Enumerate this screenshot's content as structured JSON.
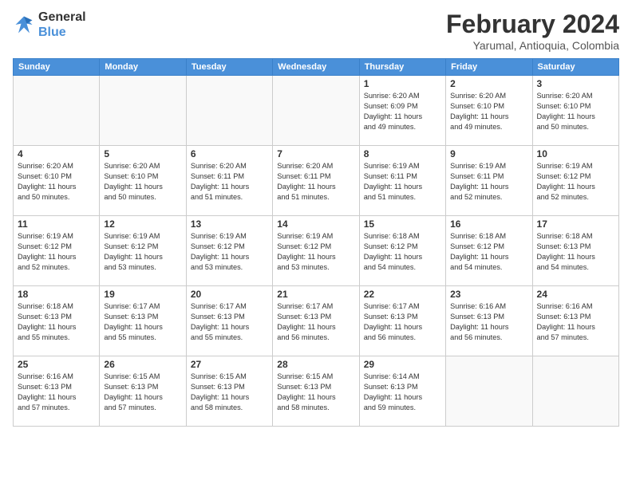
{
  "header": {
    "logo_line1": "General",
    "logo_line2": "Blue",
    "month": "February 2024",
    "location": "Yarumal, Antioquia, Colombia"
  },
  "weekdays": [
    "Sunday",
    "Monday",
    "Tuesday",
    "Wednesday",
    "Thursday",
    "Friday",
    "Saturday"
  ],
  "weeks": [
    [
      {
        "day": "",
        "info": ""
      },
      {
        "day": "",
        "info": ""
      },
      {
        "day": "",
        "info": ""
      },
      {
        "day": "",
        "info": ""
      },
      {
        "day": "1",
        "info": "Sunrise: 6:20 AM\nSunset: 6:09 PM\nDaylight: 11 hours\nand 49 minutes."
      },
      {
        "day": "2",
        "info": "Sunrise: 6:20 AM\nSunset: 6:10 PM\nDaylight: 11 hours\nand 49 minutes."
      },
      {
        "day": "3",
        "info": "Sunrise: 6:20 AM\nSunset: 6:10 PM\nDaylight: 11 hours\nand 50 minutes."
      }
    ],
    [
      {
        "day": "4",
        "info": "Sunrise: 6:20 AM\nSunset: 6:10 PM\nDaylight: 11 hours\nand 50 minutes."
      },
      {
        "day": "5",
        "info": "Sunrise: 6:20 AM\nSunset: 6:10 PM\nDaylight: 11 hours\nand 50 minutes."
      },
      {
        "day": "6",
        "info": "Sunrise: 6:20 AM\nSunset: 6:11 PM\nDaylight: 11 hours\nand 51 minutes."
      },
      {
        "day": "7",
        "info": "Sunrise: 6:20 AM\nSunset: 6:11 PM\nDaylight: 11 hours\nand 51 minutes."
      },
      {
        "day": "8",
        "info": "Sunrise: 6:19 AM\nSunset: 6:11 PM\nDaylight: 11 hours\nand 51 minutes."
      },
      {
        "day": "9",
        "info": "Sunrise: 6:19 AM\nSunset: 6:11 PM\nDaylight: 11 hours\nand 52 minutes."
      },
      {
        "day": "10",
        "info": "Sunrise: 6:19 AM\nSunset: 6:12 PM\nDaylight: 11 hours\nand 52 minutes."
      }
    ],
    [
      {
        "day": "11",
        "info": "Sunrise: 6:19 AM\nSunset: 6:12 PM\nDaylight: 11 hours\nand 52 minutes."
      },
      {
        "day": "12",
        "info": "Sunrise: 6:19 AM\nSunset: 6:12 PM\nDaylight: 11 hours\nand 53 minutes."
      },
      {
        "day": "13",
        "info": "Sunrise: 6:19 AM\nSunset: 6:12 PM\nDaylight: 11 hours\nand 53 minutes."
      },
      {
        "day": "14",
        "info": "Sunrise: 6:19 AM\nSunset: 6:12 PM\nDaylight: 11 hours\nand 53 minutes."
      },
      {
        "day": "15",
        "info": "Sunrise: 6:18 AM\nSunset: 6:12 PM\nDaylight: 11 hours\nand 54 minutes."
      },
      {
        "day": "16",
        "info": "Sunrise: 6:18 AM\nSunset: 6:12 PM\nDaylight: 11 hours\nand 54 minutes."
      },
      {
        "day": "17",
        "info": "Sunrise: 6:18 AM\nSunset: 6:13 PM\nDaylight: 11 hours\nand 54 minutes."
      }
    ],
    [
      {
        "day": "18",
        "info": "Sunrise: 6:18 AM\nSunset: 6:13 PM\nDaylight: 11 hours\nand 55 minutes."
      },
      {
        "day": "19",
        "info": "Sunrise: 6:17 AM\nSunset: 6:13 PM\nDaylight: 11 hours\nand 55 minutes."
      },
      {
        "day": "20",
        "info": "Sunrise: 6:17 AM\nSunset: 6:13 PM\nDaylight: 11 hours\nand 55 minutes."
      },
      {
        "day": "21",
        "info": "Sunrise: 6:17 AM\nSunset: 6:13 PM\nDaylight: 11 hours\nand 56 minutes."
      },
      {
        "day": "22",
        "info": "Sunrise: 6:17 AM\nSunset: 6:13 PM\nDaylight: 11 hours\nand 56 minutes."
      },
      {
        "day": "23",
        "info": "Sunrise: 6:16 AM\nSunset: 6:13 PM\nDaylight: 11 hours\nand 56 minutes."
      },
      {
        "day": "24",
        "info": "Sunrise: 6:16 AM\nSunset: 6:13 PM\nDaylight: 11 hours\nand 57 minutes."
      }
    ],
    [
      {
        "day": "25",
        "info": "Sunrise: 6:16 AM\nSunset: 6:13 PM\nDaylight: 11 hours\nand 57 minutes."
      },
      {
        "day": "26",
        "info": "Sunrise: 6:15 AM\nSunset: 6:13 PM\nDaylight: 11 hours\nand 57 minutes."
      },
      {
        "day": "27",
        "info": "Sunrise: 6:15 AM\nSunset: 6:13 PM\nDaylight: 11 hours\nand 58 minutes."
      },
      {
        "day": "28",
        "info": "Sunrise: 6:15 AM\nSunset: 6:13 PM\nDaylight: 11 hours\nand 58 minutes."
      },
      {
        "day": "29",
        "info": "Sunrise: 6:14 AM\nSunset: 6:13 PM\nDaylight: 11 hours\nand 59 minutes."
      },
      {
        "day": "",
        "info": ""
      },
      {
        "day": "",
        "info": ""
      }
    ]
  ]
}
